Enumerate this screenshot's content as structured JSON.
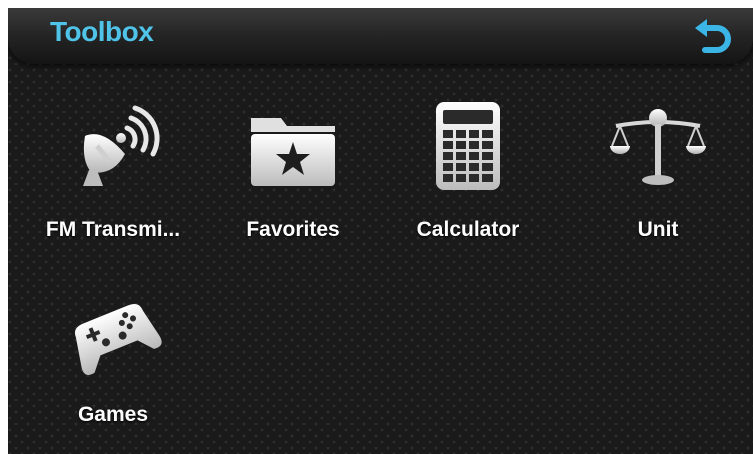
{
  "header": {
    "title": "Toolbox",
    "title_color": "#4fc3e8",
    "back_icon": "undo-arrow-icon",
    "back_icon_color": "#3bb5e6"
  },
  "apps": [
    {
      "label": "FM Transmi...",
      "icon": "satellite-dish-icon"
    },
    {
      "label": "Favorites",
      "icon": "favorites-folder-icon"
    },
    {
      "label": "Calculator",
      "icon": "calculator-icon"
    },
    {
      "label": "Unit",
      "icon": "scale-balance-icon"
    },
    {
      "label": "Games",
      "icon": "gamepad-icon"
    }
  ]
}
